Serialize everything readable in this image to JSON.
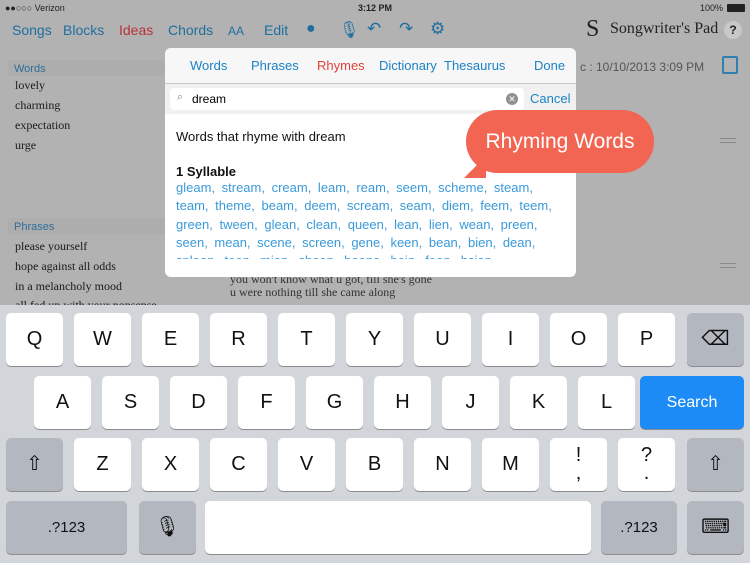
{
  "status": {
    "carrier": "●●○○○ Verizon",
    "time": "3:12 PM",
    "battery": "100%"
  },
  "toolbar": {
    "items": [
      "Songs",
      "Blocks",
      "Ideas",
      "Chords",
      "AA",
      "Edit"
    ],
    "active": "Ideas",
    "app_title": "Songwriter's Pad",
    "help": "?"
  },
  "background": {
    "date_text": "c : 10/10/2013 3:09 PM",
    "lyric1": "you won't know what u got, till she's gone",
    "lyric2": "u were nothing till she came along"
  },
  "sidebar": {
    "words_header": "Words",
    "words": [
      "lovely",
      "charming",
      "expectation",
      "urge"
    ],
    "phrases_header": "Phrases",
    "phrases": [
      "please yourself",
      "hope against all odds",
      "in a melancholy mood",
      "all fed up with your nonsense"
    ]
  },
  "popover": {
    "tabs": [
      "Words",
      "Phrases",
      "Rhymes",
      "Dictionary",
      "Thesaurus"
    ],
    "active_tab": "Rhymes",
    "done": "Done",
    "search_value": "dream",
    "cancel": "Cancel",
    "heading": "Words that rhyme with dream",
    "section": "1 Syllable",
    "rhymes": "gleam, stream, cream, leam, ream, seem, scheme, steam, team, theme, beam, deem, scream, seam, diem, feem, teem, green, tween, glean, clean, queen, lean, lien, wean, preen, seen, mean, scene, screen, gene, keen, bean, bien, dean, spleen, teen, mien, sheen, beene, bein, feen, hsien"
  },
  "callout": "Rhyming Words",
  "colors": {
    "accent": "#1b82c5",
    "active": "#e0403b",
    "callout": "#f26552",
    "search_key": "#1d8bf5"
  },
  "keyboard": {
    "row1": [
      "Q",
      "W",
      "E",
      "R",
      "T",
      "Y",
      "U",
      "I",
      "O",
      "P"
    ],
    "row2": [
      "A",
      "S",
      "D",
      "F",
      "G",
      "H",
      "J",
      "K",
      "L"
    ],
    "row3": [
      "Z",
      "X",
      "C",
      "V",
      "B",
      "N",
      "M",
      "!\n,",
      "?\n."
    ],
    "search": "Search",
    "numbers": ".?123"
  }
}
